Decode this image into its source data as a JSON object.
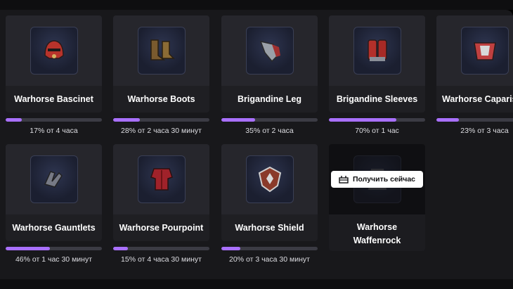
{
  "rewards": [
    {
      "title": "Warhorse Bascinet",
      "progress": 17,
      "status": "17% от 4 часа",
      "icon": "helmet-icon",
      "color": "#c0392b"
    },
    {
      "title": "Warhorse Boots",
      "progress": 28,
      "status": "28% от 2 часа 30 минут",
      "icon": "boots-icon",
      "color": "#8b6b35"
    },
    {
      "title": "Brigandine Leg",
      "progress": 35,
      "status": "35% от 2 часа",
      "icon": "leg-armor-icon",
      "color": "#a03030"
    },
    {
      "title": "Brigandine Sleeves",
      "progress": 70,
      "status": "70% от 1 час",
      "icon": "sleeves-icon",
      "color": "#b3302a"
    },
    {
      "title": "Warhorse Caparis",
      "progress": 23,
      "status": "23% от 3 часа",
      "icon": "caparison-icon",
      "color": "#c04040"
    },
    {
      "title": "Warhorse Gauntlets",
      "progress": 46,
      "status": "46% от 1 час 30 минут",
      "icon": "gauntlets-icon",
      "color": "#777a85"
    },
    {
      "title": "Warhorse Pourpoint",
      "progress": 15,
      "status": "15% от 4 часа 30 минут",
      "icon": "pourpoint-icon",
      "color": "#a0222a"
    },
    {
      "title": "Warhorse Shield",
      "progress": 20,
      "status": "20% от 3 часа 30 минут",
      "icon": "shield-icon",
      "color": "#8a3a2a"
    }
  ],
  "claimable": {
    "title_line1": "Warhorse",
    "title_line2": "Waffenrock",
    "button_label": "Получить сейчас",
    "button_icon": "gift-icon"
  },
  "accent": "#a970ff"
}
